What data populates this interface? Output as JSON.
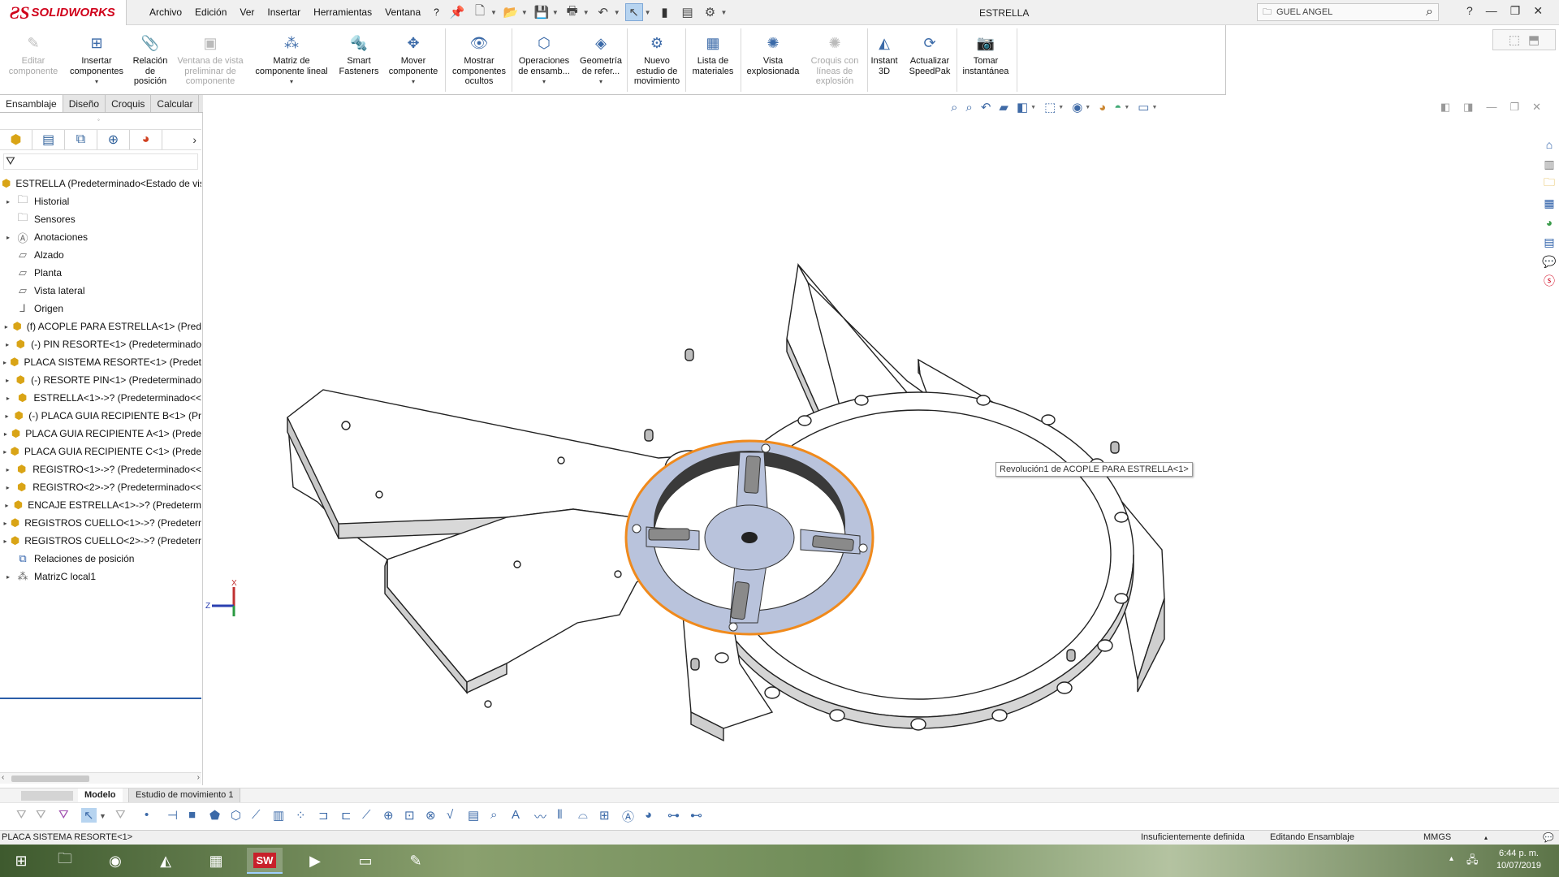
{
  "app": {
    "brand": "SOLIDWORKS",
    "document_title": "ESTRELLA",
    "user_search": "GUEL ANGEL",
    "help": "?"
  },
  "menu": [
    "Archivo",
    "Edición",
    "Ver",
    "Insertar",
    "Herramientas",
    "Ventana",
    "?"
  ],
  "ribbon": {
    "items": [
      {
        "label": "Editar\ncomponente",
        "icon": "edit-component-icon",
        "enabled": false
      },
      {
        "label": "Insertar\ncomponentes",
        "icon": "insert-components-icon",
        "enabled": true
      },
      {
        "label": "Relación\nde\nposición",
        "icon": "mate-icon",
        "enabled": true
      },
      {
        "label": "Ventana de vista\npreliminar de\ncomponente",
        "icon": "preview-window-icon",
        "enabled": false
      },
      {
        "label": "Matriz de\ncomponente lineal",
        "icon": "linear-pattern-icon",
        "enabled": true
      },
      {
        "label": "Smart\nFasteners",
        "icon": "smart-fasteners-icon",
        "enabled": true
      },
      {
        "label": "Mover\ncomponente",
        "icon": "move-component-icon",
        "enabled": true
      },
      {
        "label": "Mostrar\ncomponentes\nocultos",
        "icon": "show-hidden-icon",
        "enabled": true
      },
      {
        "label": "Operaciones\nde ensamb...",
        "icon": "assembly-features-icon",
        "enabled": true
      },
      {
        "label": "Geometría\nde refer...",
        "icon": "reference-geometry-icon",
        "enabled": true
      },
      {
        "label": "Nuevo\nestudio de\nmovimiento",
        "icon": "motion-study-icon",
        "enabled": true
      },
      {
        "label": "Lista de\nmateriales",
        "icon": "bom-icon",
        "enabled": true
      },
      {
        "label": "Vista\nexplosionada",
        "icon": "exploded-view-icon",
        "enabled": true
      },
      {
        "label": "Croquis con\nlíneas de\nexplosión",
        "icon": "explode-line-sketch-icon",
        "enabled": false
      },
      {
        "label": "Instant\n3D",
        "icon": "instant3d-icon",
        "enabled": true
      },
      {
        "label": "Actualizar\nSpeedPak",
        "icon": "speedpak-icon",
        "enabled": true
      },
      {
        "label": "Tomar\ninstantánea",
        "icon": "snapshot-icon",
        "enabled": true
      }
    ]
  },
  "command_tabs": [
    "Ensamblaje",
    "Diseño",
    "Croquis",
    "Calcular"
  ],
  "feature_tree": {
    "root": "ESTRELLA  (Predeterminado<Estado de vis",
    "items": [
      {
        "label": "Historial",
        "icon": "history-folder-icon",
        "expand": true
      },
      {
        "label": "Sensores",
        "icon": "sensors-folder-icon",
        "expand": false
      },
      {
        "label": "Anotaciones",
        "icon": "annotations-folder-icon",
        "expand": true
      },
      {
        "label": "Alzado",
        "icon": "plane-icon",
        "expand": false
      },
      {
        "label": "Planta",
        "icon": "plane-icon",
        "expand": false
      },
      {
        "label": "Vista lateral",
        "icon": "plane-icon",
        "expand": false
      },
      {
        "label": "Origen",
        "icon": "origin-icon",
        "expand": false
      },
      {
        "label": "(f) ACOPLE PARA ESTRELLA<1> (Pred",
        "icon": "part-icon",
        "expand": true
      },
      {
        "label": "(-) PIN RESORTE<1> (Predeterminado",
        "icon": "part-icon",
        "expand": true
      },
      {
        "label": "PLACA SISTEMA RESORTE<1> (Predet",
        "icon": "part-icon",
        "expand": true
      },
      {
        "label": "(-) RESORTE PIN<1> (Predeterminado",
        "icon": "part-icon",
        "expand": true
      },
      {
        "label": "ESTRELLA<1>->? (Predeterminado<<",
        "icon": "part-icon",
        "expand": true
      },
      {
        "label": "(-) PLACA GUIA RECIPIENTE B<1> (Pr",
        "icon": "part-icon",
        "expand": true
      },
      {
        "label": "PLACA GUIA RECIPIENTE A<1> (Prede",
        "icon": "part-icon",
        "expand": true
      },
      {
        "label": "PLACA GUIA RECIPIENTE C<1> (Prede",
        "icon": "part-icon",
        "expand": true
      },
      {
        "label": "REGISTRO<1>->? (Predeterminado<<",
        "icon": "part-icon",
        "expand": true
      },
      {
        "label": "REGISTRO<2>->? (Predeterminado<<",
        "icon": "part-icon",
        "expand": true
      },
      {
        "label": "ENCAJE ESTRELLA<1>->? (Predeterm",
        "icon": "part-icon",
        "expand": true
      },
      {
        "label": "REGISTROS CUELLO<1>->? (Predeterr",
        "icon": "part-icon",
        "expand": true
      },
      {
        "label": "REGISTROS CUELLO<2>->? (Predeterr",
        "icon": "part-icon",
        "expand": true
      },
      {
        "label": "Relaciones de posición",
        "icon": "mates-folder-icon",
        "expand": false
      },
      {
        "label": "MatrizC local1",
        "icon": "pattern-icon",
        "expand": true
      }
    ]
  },
  "viewport": {
    "tooltip": "Revolución1 de ACOPLE PARA ESTRELLA<1>",
    "triad": {
      "x": "X",
      "z": "Z"
    }
  },
  "bottom_tabs": [
    "Modelo",
    "Estudio de movimiento 1"
  ],
  "status": {
    "selection": "PLACA SISTEMA RESORTE<1>",
    "definition": "Insuficientemente definida",
    "mode": "Editando Ensamblaje",
    "units": "MMGS"
  },
  "clock": {
    "time": "6:44 p. m.",
    "date": "10/07/2019"
  },
  "colors": {
    "brand_red": "#d0021b",
    "selection_orange": "#f08a1c",
    "highlight_fill": "#b9c3dc",
    "tree_blue": "#2b5ea8"
  }
}
